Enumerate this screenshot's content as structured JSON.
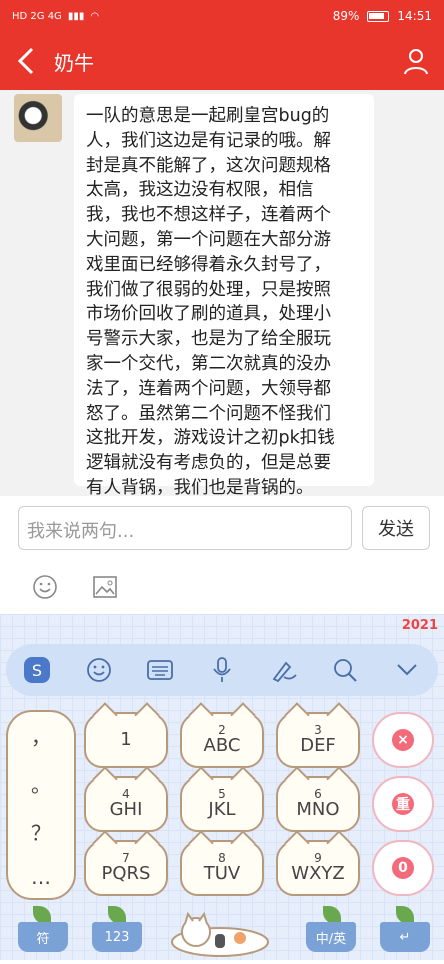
{
  "status": {
    "network_left": "HD 2G 4G",
    "battery": "89%",
    "time": "14:51"
  },
  "appbar": {
    "title": "奶牛"
  },
  "message": {
    "lines": [
      "一队的意思是一起刷皇宫bug的",
      "人，我们这边是有记录的哦。解",
      "封是真不能解了，这次问题规格",
      "太高，我这边没有权限，相信",
      "我，我也不想这样子，连着两个",
      "大问题，第一个问题在大部分游",
      "戏里面已经够得着永久封号了，",
      "我们做了很弱的处理，只是按照",
      "市场价回收了刷的道具，处理小",
      "号警示大家，也是为了给全服玩",
      "家一个交代，第二次就真的没办",
      "法了，连着两个问题，大领导都",
      "怒了。虽然第二个问题不怪我们",
      "这批开发，游戏设计之初pk扣钱",
      "逻辑就没有考虑负的，但是总要",
      "有人背锅，我们也是背锅的。"
    ]
  },
  "input": {
    "placeholder": "我来说两句...",
    "send_label": "发送"
  },
  "keyboard": {
    "brand": "2021",
    "side_keys": [
      "，",
      "。",
      "？",
      "…"
    ],
    "keys": [
      {
        "num": "",
        "let": "1"
      },
      {
        "num": "2",
        "let": "ABC"
      },
      {
        "num": "3",
        "let": "DEF"
      },
      {
        "num": "4",
        "let": "GHI"
      },
      {
        "num": "5",
        "let": "JKL"
      },
      {
        "num": "6",
        "let": "MNO"
      },
      {
        "num": "7",
        "let": "PQRS"
      },
      {
        "num": "8",
        "let": "TUV"
      },
      {
        "num": "9",
        "let": "WXYZ"
      }
    ],
    "paw_keys": [
      "×",
      "重",
      "0"
    ],
    "bottom": {
      "symbol": "符",
      "num": "123",
      "lang": "中/英",
      "enter": "↵"
    }
  }
}
